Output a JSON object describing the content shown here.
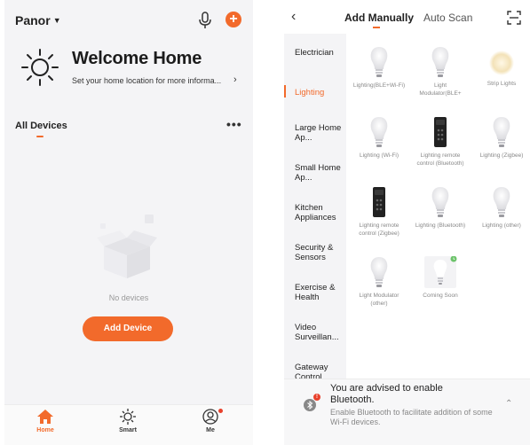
{
  "left": {
    "home_name": "Panor",
    "welcome_title": "Welcome Home",
    "location_text": "Set your home location for more informa...",
    "all_devices": "All Devices",
    "no_devices": "No devices",
    "add_device": "Add Device",
    "tabs": [
      {
        "label": "Home"
      },
      {
        "label": "Smart"
      },
      {
        "label": "Me"
      }
    ]
  },
  "right": {
    "tab_manual": "Add Manually",
    "tab_auto": "Auto Scan",
    "categories": [
      {
        "label": "Electrician"
      },
      {
        "label": "Lighting"
      },
      {
        "label": "Large Home Ap..."
      },
      {
        "label": "Small Home Ap..."
      },
      {
        "label": "Kitchen Appliances"
      },
      {
        "label": "Security & Sensors"
      },
      {
        "label": "Exercise & Health"
      },
      {
        "label": "Video Surveillan..."
      },
      {
        "label": "Gateway Control"
      }
    ],
    "devices": [
      {
        "label": "Lighting(BLE+Wi-Fi)"
      },
      {
        "label": "Light Modulator(BLE+"
      },
      {
        "label": "Strip Lights"
      },
      {
        "label": "Lighting (Wi-Fi)"
      },
      {
        "label": "Lighting remote control (Bluetooth)"
      },
      {
        "label": "Lighting (Zigbee)"
      },
      {
        "label": "Lighting remote control (Zigbee)"
      },
      {
        "label": "Lighting (Bluetooth)"
      },
      {
        "label": "Lighting (other)"
      },
      {
        "label": "Light Modulator (other)"
      },
      {
        "label": "Coming Soon"
      }
    ],
    "bluetooth_title": "You are advised to enable Bluetooth.",
    "bluetooth_desc": "Enable Bluetooth to facilitate addition of some Wi-Fi devices.",
    "bluetooth_badge": "!"
  },
  "colors": {
    "accent": "#f26a2b",
    "badge": "#e8412c"
  }
}
